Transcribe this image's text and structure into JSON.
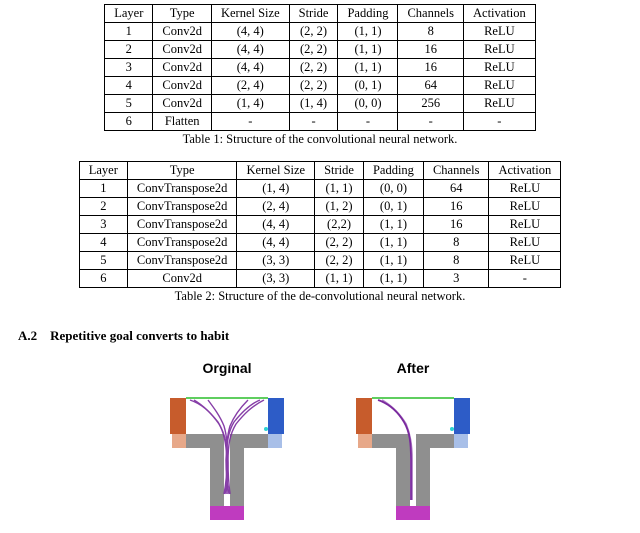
{
  "table1": {
    "headers": [
      "Layer",
      "Type",
      "Kernel Size",
      "Stride",
      "Padding",
      "Channels",
      "Activation"
    ],
    "rows": [
      [
        "1",
        "Conv2d",
        "(4, 4)",
        "(2, 2)",
        "(1, 1)",
        "8",
        "ReLU"
      ],
      [
        "2",
        "Conv2d",
        "(4, 4)",
        "(2, 2)",
        "(1, 1)",
        "16",
        "ReLU"
      ],
      [
        "3",
        "Conv2d",
        "(4, 4)",
        "(2, 2)",
        "(1, 1)",
        "16",
        "ReLU"
      ],
      [
        "4",
        "Conv2d",
        "(2, 4)",
        "(2, 2)",
        "(0, 1)",
        "64",
        "ReLU"
      ],
      [
        "5",
        "Conv2d",
        "(1, 4)",
        "(1, 4)",
        "(0, 0)",
        "256",
        "ReLU"
      ],
      [
        "6",
        "Flatten",
        "-",
        "-",
        "-",
        "-",
        "-"
      ]
    ],
    "caption": "Table 1: Structure of the convolutional neural network."
  },
  "table2": {
    "headers": [
      "Layer",
      "Type",
      "Kernel Size",
      "Stride",
      "Padding",
      "Channels",
      "Activation"
    ],
    "rows": [
      [
        "1",
        "ConvTranspose2d",
        "(1, 4)",
        "(1, 1)",
        "(0, 0)",
        "64",
        "ReLU"
      ],
      [
        "2",
        "ConvTranspose2d",
        "(2, 4)",
        "(1, 2)",
        "(0, 1)",
        "16",
        "ReLU"
      ],
      [
        "3",
        "ConvTranspose2d",
        "(4, 4)",
        "(2,2)",
        "(1, 1)",
        "16",
        "ReLU"
      ],
      [
        "4",
        "ConvTranspose2d",
        "(4, 4)",
        "(2, 2)",
        "(1, 1)",
        "8",
        "ReLU"
      ],
      [
        "5",
        "ConvTranspose2d",
        "(3, 3)",
        "(2, 2)",
        "(1, 1)",
        "8",
        "ReLU"
      ],
      [
        "6",
        "Conv2d",
        "(3, 3)",
        "(1, 1)",
        "(1, 1)",
        "3",
        "-"
      ]
    ],
    "caption": "Table 2: Structure of the de-convolutional neural network."
  },
  "sectionA2": {
    "number": "A.2",
    "title": "Repetitive goal converts to habit"
  },
  "figureA2": {
    "left_label": "Orginal",
    "right_label": "After"
  },
  "chart_data": [
    {
      "type": "table",
      "title": "Table 1: Structure of the convolutional neural network.",
      "columns": [
        "Layer",
        "Type",
        "Kernel Size",
        "Stride",
        "Padding",
        "Channels",
        "Activation"
      ],
      "rows": [
        [
          1,
          "Conv2d",
          [
            4,
            4
          ],
          [
            2,
            2
          ],
          [
            1,
            1
          ],
          8,
          "ReLU"
        ],
        [
          2,
          "Conv2d",
          [
            4,
            4
          ],
          [
            2,
            2
          ],
          [
            1,
            1
          ],
          16,
          "ReLU"
        ],
        [
          3,
          "Conv2d",
          [
            4,
            4
          ],
          [
            2,
            2
          ],
          [
            1,
            1
          ],
          16,
          "ReLU"
        ],
        [
          4,
          "Conv2d",
          [
            2,
            4
          ],
          [
            2,
            2
          ],
          [
            0,
            1
          ],
          64,
          "ReLU"
        ],
        [
          5,
          "Conv2d",
          [
            1,
            4
          ],
          [
            1,
            4
          ],
          [
            0,
            0
          ],
          256,
          "ReLU"
        ],
        [
          6,
          "Flatten",
          null,
          null,
          null,
          null,
          null
        ]
      ]
    },
    {
      "type": "table",
      "title": "Table 2: Structure of the de-convolutional neural network.",
      "columns": [
        "Layer",
        "Type",
        "Kernel Size",
        "Stride",
        "Padding",
        "Channels",
        "Activation"
      ],
      "rows": [
        [
          1,
          "ConvTranspose2d",
          [
            1,
            4
          ],
          [
            1,
            1
          ],
          [
            0,
            0
          ],
          64,
          "ReLU"
        ],
        [
          2,
          "ConvTranspose2d",
          [
            2,
            4
          ],
          [
            1,
            2
          ],
          [
            0,
            1
          ],
          16,
          "ReLU"
        ],
        [
          3,
          "ConvTranspose2d",
          [
            4,
            4
          ],
          [
            2,
            2
          ],
          [
            1,
            1
          ],
          16,
          "ReLU"
        ],
        [
          4,
          "ConvTranspose2d",
          [
            4,
            4
          ],
          [
            2,
            2
          ],
          [
            1,
            1
          ],
          8,
          "ReLU"
        ],
        [
          5,
          "ConvTranspose2d",
          [
            3,
            3
          ],
          [
            2,
            2
          ],
          [
            1,
            1
          ],
          8,
          "ReLU"
        ],
        [
          6,
          "Conv2d",
          [
            3,
            3
          ],
          [
            1,
            1
          ],
          [
            1,
            1
          ],
          3,
          null
        ]
      ]
    }
  ]
}
